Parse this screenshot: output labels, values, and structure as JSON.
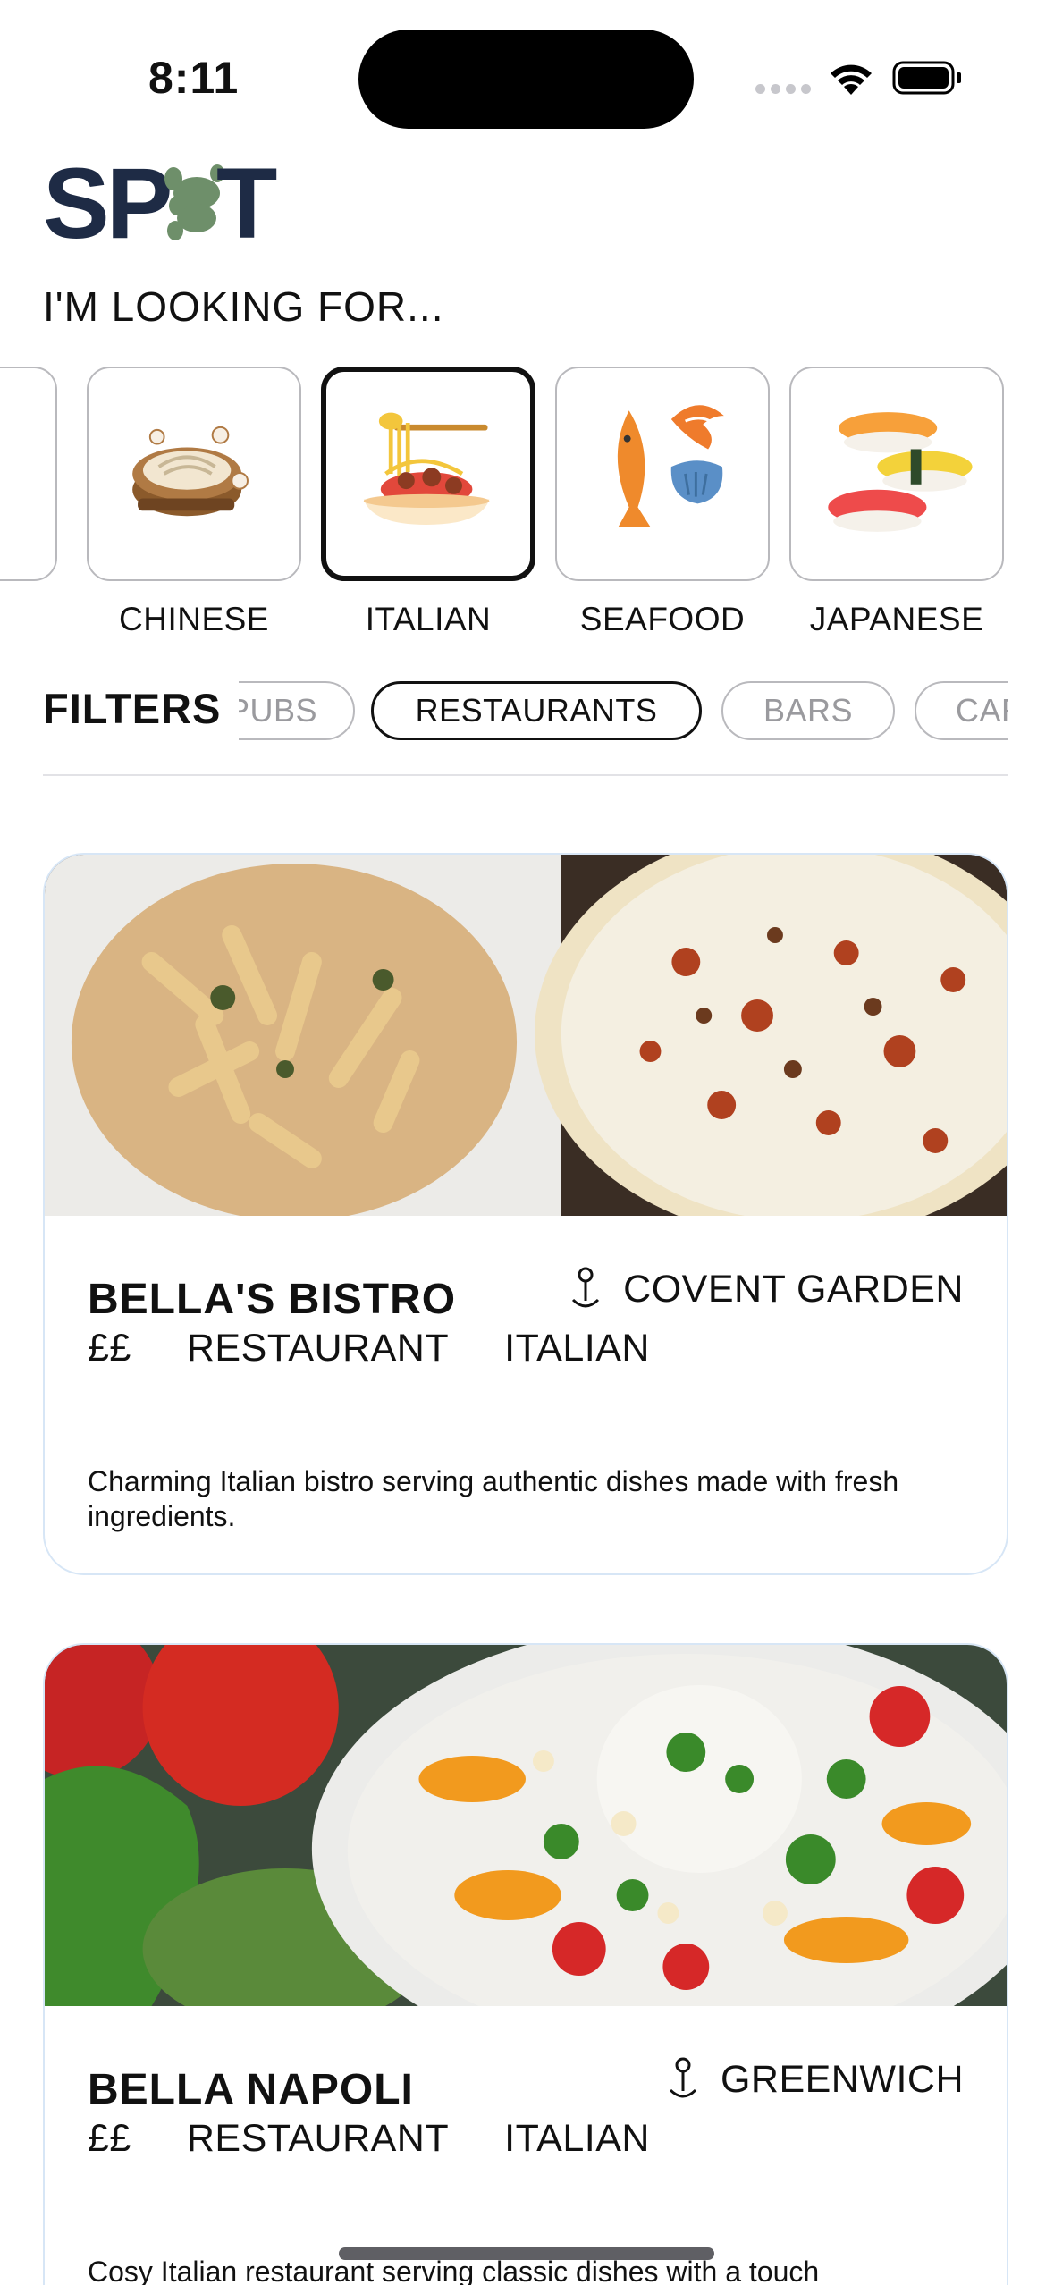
{
  "status_bar": {
    "time": "8:11"
  },
  "logo": {
    "text": "SPOT"
  },
  "heading": "I'M LOOKING FOR...",
  "categories": [
    {
      "label": "CHINESE",
      "icon": "dumpling-basket-icon",
      "selected": false
    },
    {
      "label": "ITALIAN",
      "icon": "pasta-plate-icon",
      "selected": true
    },
    {
      "label": "SEAFOOD",
      "icon": "fish-shrimp-icon",
      "selected": false
    },
    {
      "label": "JAPANESE",
      "icon": "sushi-icon",
      "selected": false
    }
  ],
  "filters": {
    "label": "FILTERS",
    "chips": [
      {
        "label": "PUBS",
        "active": false
      },
      {
        "label": "RESTAURANTS",
        "active": true
      },
      {
        "label": "BARS",
        "active": false
      },
      {
        "label": "CAFES",
        "active": false
      }
    ]
  },
  "listings": [
    {
      "name": "BELLA'S BISTRO",
      "location": "COVENT GARDEN",
      "price": "££",
      "type": "RESTAURANT",
      "cuisine": "ITALIAN",
      "description": "Charming Italian bistro serving authentic dishes made with fresh ingredients."
    },
    {
      "name": "BELLA NAPOLI",
      "location": "GREENWICH",
      "price": "££",
      "type": "RESTAURANT",
      "cuisine": "ITALIAN",
      "description": "Cosy Italian restaurant serving classic dishes with a touch"
    }
  ],
  "colors": {
    "logo_navy": "#1e2b45",
    "logo_green": "#6e8f6a",
    "card_border": "#d7e6f6"
  }
}
